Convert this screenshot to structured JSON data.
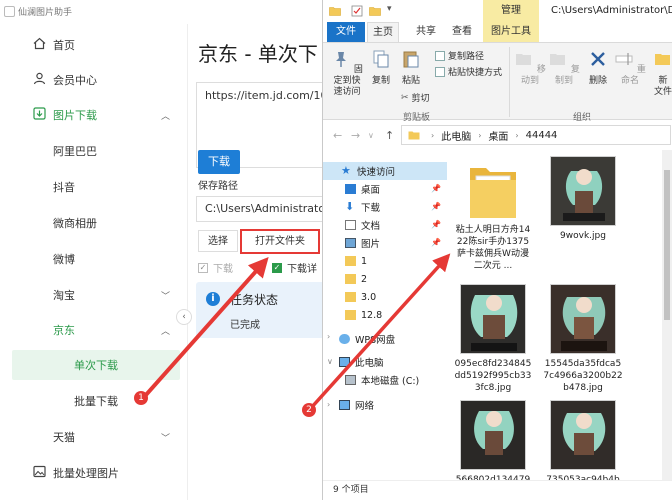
{
  "app": {
    "title": "仙澜图片助手",
    "sidebar": {
      "items": [
        {
          "label": "首页",
          "icon": "home-icon"
        },
        {
          "label": "会员中心",
          "icon": "user-icon"
        },
        {
          "label": "图片下载",
          "icon": "download-icon",
          "expanded": true
        },
        {
          "label": "阿里巴巴"
        },
        {
          "label": "抖音"
        },
        {
          "label": "微商相册"
        },
        {
          "label": "微博"
        },
        {
          "label": "淘宝"
        },
        {
          "label": "京东",
          "expanded": true
        },
        {
          "label": "单次下载",
          "active": true
        },
        {
          "label": "批量下载"
        },
        {
          "label": "天猫"
        },
        {
          "label": "批量处理图片",
          "icon": "image-icon"
        }
      ]
    },
    "page_title": "京东 - 单次下",
    "url_value": "https://item.jd.com/100",
    "download_label": "下载",
    "save_path_label": "保存路径",
    "save_path_value": "C:\\Users\\Administrator",
    "choose_label": "选择",
    "open_folder_label": "打开文件夹",
    "checkbox1_label": "下载",
    "checkbox2_label": "下载详",
    "status_title": "任务状态",
    "status_text": "已完成",
    "accent": "#2b9a4a",
    "primary": "#1e7ed6",
    "highlight": "#e53935"
  },
  "explorer": {
    "manage_tab": "管理",
    "path_title": "C:\\Users\\Administrator\\Desk",
    "tabs": {
      "file": "文件",
      "home": "主页",
      "share": "共享",
      "view": "查看",
      "picture_tools": "图片工具"
    },
    "ribbon": {
      "pin_quick": "固定到快\n速访问",
      "copy": "复制",
      "paste": "粘贴",
      "copy_path": "复制路径",
      "paste_shortcut": "粘贴快捷方式",
      "cut": "剪切",
      "clipboard_group": "剪贴板",
      "move_to": "移动到",
      "copy_to": "复制到",
      "delete": "删除",
      "rename": "重命名",
      "new": "新",
      "new2": "文件",
      "organize_group": "组织"
    },
    "breadcrumb": [
      "此电脑",
      "桌面",
      "44444"
    ],
    "tree": {
      "quick_access": "快速访问",
      "items": [
        "桌面",
        "下载",
        "文档",
        "图片",
        "1",
        "2",
        "3.0",
        "12.8"
      ],
      "wps": "WPS网盘",
      "this_pc": "此电脑",
      "local_disk": "本地磁盘 (C:)",
      "network": "网络"
    },
    "files": [
      {
        "name": "粘土人明日方舟1422陈sir手办1375萨卡兹佣兵W动漫二次元 ...",
        "type": "folder"
      },
      {
        "name": "9wovk.jpg",
        "type": "image"
      },
      {
        "name": "095ec8fd234845dd5192f995cb333fc8.jpg",
        "type": "image"
      },
      {
        "name": "15545da35fdca57c4966a3200b22b478.jpg",
        "type": "image"
      },
      {
        "name": "566802d134479",
        "type": "image"
      },
      {
        "name": "735053ac94b4b",
        "type": "image"
      }
    ],
    "status": "9 个项目"
  },
  "annotations": {
    "marker1": "1",
    "marker2": "2"
  }
}
